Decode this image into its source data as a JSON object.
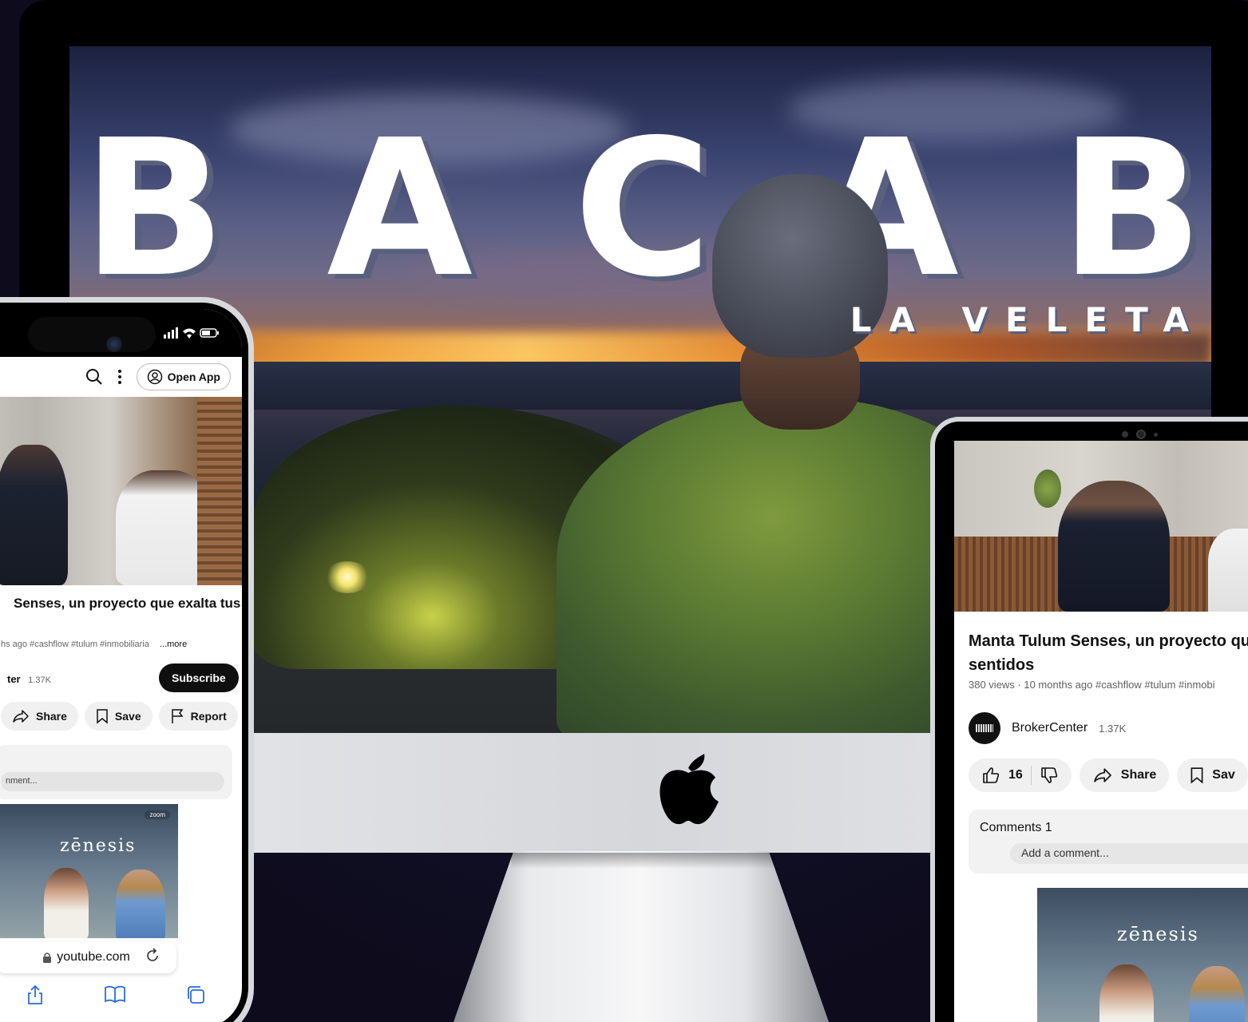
{
  "desktop": {
    "hero_letters": [
      "B",
      "A",
      "C",
      "A",
      "B"
    ],
    "hero_subtitle": "LA VELETA"
  },
  "phone": {
    "status_icons": "signal wifi battery",
    "topbar": {
      "search_icon": "search-icon",
      "menu_icon": "more-vert-icon",
      "open_app_label": "Open App"
    },
    "video": {
      "title": "Senses, un proyecto que exalta tus",
      "meta": "hs ago  #cashflow #tulum #inmobiliaria",
      "more_label": "...more",
      "channel_name": "ter",
      "channel_subs": "1.37K",
      "subscribe_label": "Subscribe"
    },
    "actions": [
      {
        "label": "Share",
        "icon": "share-icon"
      },
      {
        "label": "Save",
        "icon": "bookmark-icon"
      },
      {
        "label": "Report",
        "icon": "flag-icon"
      }
    ],
    "comment_placeholder": "nment...",
    "ad": {
      "brand": "zēnesis",
      "badge": "zoom"
    },
    "browser": {
      "url": "youtube.com",
      "toolbar_icons": [
        "share-icon",
        "bookmarks-icon",
        "tabs-icon"
      ]
    }
  },
  "tablet": {
    "video": {
      "title_line1": "Manta Tulum Senses, un proyecto qu",
      "title_line2": "sentidos",
      "meta": "380 views · 10 months ago  #cashflow #tulum #inmobi",
      "channel_name": "BrokerCenter",
      "channel_subs": "1.37K"
    },
    "actions": {
      "like_count": "16",
      "share_label": "Share",
      "save_label": "Sav"
    },
    "comments": {
      "label": "Comments 1",
      "placeholder": "Add a comment..."
    },
    "ad": {
      "brand": "zēnesis"
    }
  },
  "colors": {
    "youtube_text": "#0f0f0f",
    "pill_bg": "#f0f0f0",
    "ios_blue": "#2a6be0",
    "hero_shadow": "#59607e"
  }
}
